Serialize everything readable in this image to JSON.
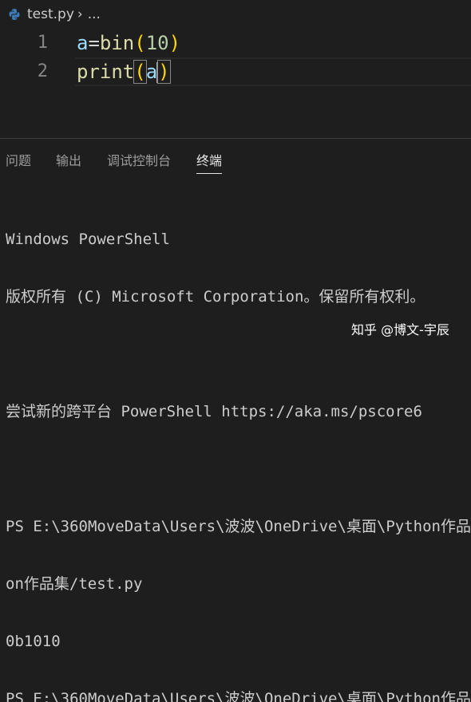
{
  "breadcrumb": {
    "icon": "python-icon",
    "file": "test.py",
    "separator": "›",
    "ellipsis": "..."
  },
  "editor": {
    "lines": [
      {
        "number": "1",
        "tokens": [
          "a",
          "=",
          "bin",
          "(",
          "10",
          ")"
        ]
      },
      {
        "number": "2",
        "tokens": [
          "print",
          "(",
          "a",
          ")"
        ]
      }
    ]
  },
  "panel": {
    "tabs": [
      {
        "label": "问题"
      },
      {
        "label": "输出"
      },
      {
        "label": "调试控制台"
      },
      {
        "label": "终端",
        "active": true
      }
    ]
  },
  "terminal": {
    "lines": [
      "Windows PowerShell",
      "版权所有 (C) Microsoft Corporation。保留所有权利。",
      "",
      "尝试新的跨平台 PowerShell https://aka.ms/pscore6",
      "",
      "PS E:\\360MoveData\\Users\\波波\\OneDrive\\桌面\\Python作品",
      "on作品集/test.py",
      "0b1010",
      "PS E:\\360MoveData\\Users\\波波\\OneDrive\\桌面\\Python作品"
    ]
  },
  "watermark": "知乎 @博文-宇辰",
  "colors": {
    "background": "#1e1e1e",
    "variable": "#9cdcfe",
    "function": "#dcdcaa",
    "number": "#b5cea8",
    "bracket": "#ffd700"
  }
}
